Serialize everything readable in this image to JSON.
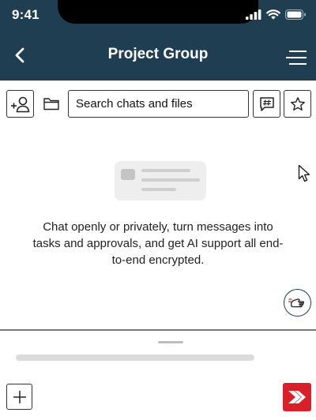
{
  "status_bar": {
    "time": "9:41"
  },
  "header": {
    "title": "Project Group",
    "back_icon": "chevron-left-icon",
    "menu_icon": "menu-icon",
    "bg_color": "#1f3e52"
  },
  "toolbar": {
    "add_member_icon": "add-user-icon",
    "folder_icon": "folder-icon",
    "search_placeholder": "Search chats and files",
    "channel_icon": "hashtag-chat-icon",
    "favorite_icon": "star-icon"
  },
  "empty_state": {
    "message": "Chat openly or privately, turn messages into tasks and approvals, and get AI support all end-to-end encrypted."
  },
  "composer": {
    "add_icon": "plus-icon",
    "send_icon": "send-icon",
    "send_color": "#d8202b"
  }
}
